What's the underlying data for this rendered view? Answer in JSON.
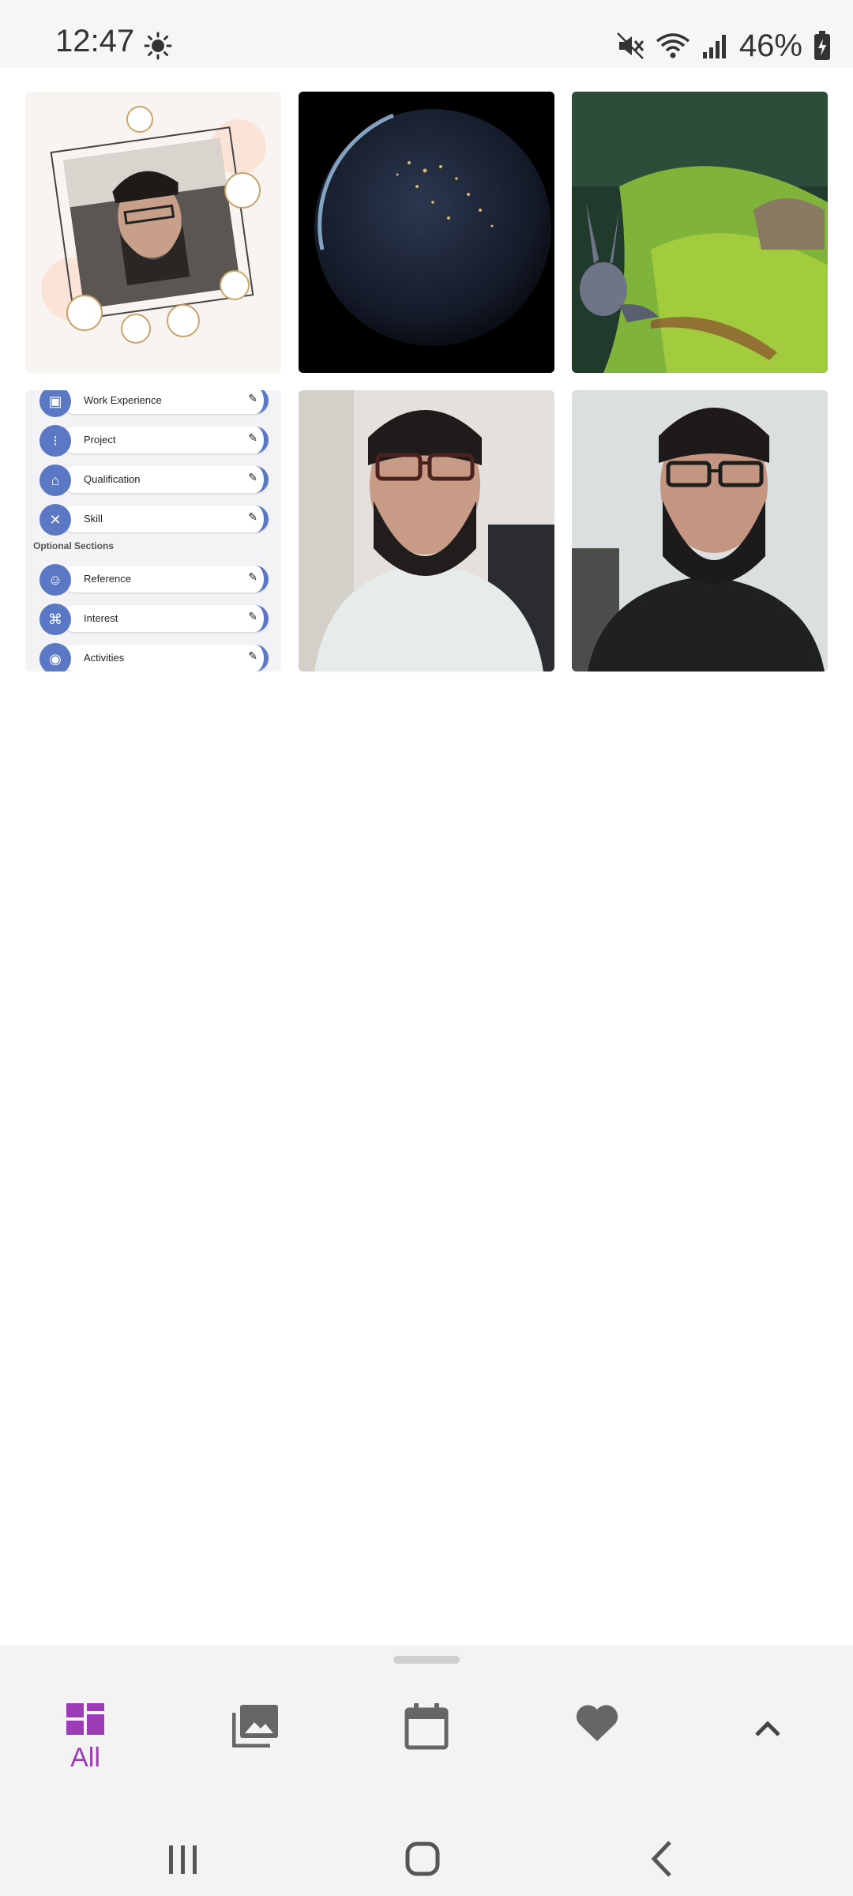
{
  "status_bar": {
    "time": "12:47",
    "battery": "46%",
    "icons": [
      "sun-icon",
      "mute-icon",
      "wifi-icon",
      "signal-icon",
      "battery-charging-icon"
    ]
  },
  "gallery": {
    "items": [
      {
        "name": "photo-framed-portrait"
      },
      {
        "name": "photo-earth-night"
      },
      {
        "name": "photo-rabbit-grass"
      },
      {
        "name": "screenshot-resume-sections"
      },
      {
        "name": "photo-selfie-white-shirt"
      },
      {
        "name": "photo-selfie-black-jacket"
      }
    ],
    "resume": {
      "rows": [
        {
          "label": "Work Experience",
          "icon": "briefcase-icon"
        },
        {
          "label": "Project",
          "icon": "project-icon"
        },
        {
          "label": "Qualification",
          "icon": "graduation-cap-icon"
        },
        {
          "label": "Skill",
          "icon": "tools-icon"
        }
      ],
      "section_title": "Optional Sections",
      "optional_rows": [
        {
          "label": "Reference",
          "icon": "people-icon"
        },
        {
          "label": "Interest",
          "icon": "command-icon"
        },
        {
          "label": "Activities",
          "icon": "ball-icon"
        }
      ]
    }
  },
  "bottom_bar": {
    "tabs": [
      {
        "label": "All",
        "icon": "grid-icon",
        "active": true
      },
      {
        "label": "",
        "icon": "photos-icon"
      },
      {
        "label": "",
        "icon": "calendar-icon"
      },
      {
        "label": "",
        "icon": "heart-icon"
      },
      {
        "label": "",
        "icon": "chevron-up-icon"
      }
    ],
    "accent": "#9b3bb5"
  },
  "nav_bar": {
    "buttons": [
      "recents-icon",
      "home-icon",
      "back-icon"
    ]
  }
}
